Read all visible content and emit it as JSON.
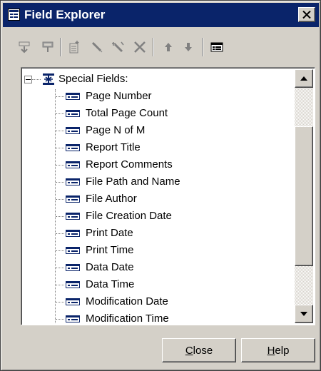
{
  "window": {
    "title": "Field Explorer"
  },
  "toolbar": {
    "buttons": [
      {
        "icon": "insert-field-icon"
      },
      {
        "icon": "browse-data-icon"
      },
      {
        "icon": "new-field-icon"
      },
      {
        "icon": "edit-field-icon"
      },
      {
        "icon": "rename-field-icon"
      },
      {
        "icon": "delete-field-icon"
      },
      {
        "icon": "move-up-icon"
      },
      {
        "icon": "move-down-icon"
      },
      {
        "icon": "show-field-type-icon"
      }
    ]
  },
  "tree": {
    "root_label": "Special Fields:",
    "items": [
      "Page Number",
      "Total Page Count",
      "Page N of M",
      "Report Title",
      "Report Comments",
      "File Path and Name",
      "File Author",
      "File Creation Date",
      "Print Date",
      "Print Time",
      "Data Date",
      "Data Time",
      "Modification Date",
      "Modification Time"
    ]
  },
  "buttons": {
    "close_label": "Close",
    "help_label": "Help"
  },
  "colors": {
    "titlebar": "#0a246a",
    "face": "#d4d0c8",
    "field_icon": "#0a246a"
  }
}
